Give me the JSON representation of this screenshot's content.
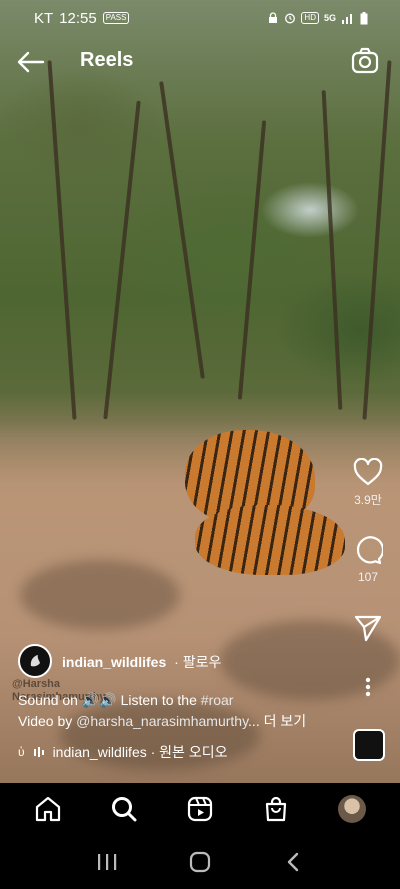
{
  "status_bar": {
    "carrier": "KT",
    "time": "12:55",
    "notification_badge": "PASS",
    "right_icons": [
      "lock-icon",
      "alarm-icon",
      "hd-icon",
      "5g-icon",
      "signal-icon",
      "battery-icon"
    ],
    "hd": "HD",
    "network": "5G"
  },
  "header": {
    "title": "Reels"
  },
  "actions": {
    "like_count": "3.9만",
    "comment_count": "107"
  },
  "watermark": {
    "line1": "@Harsha",
    "line2": "Narasimhamurthy"
  },
  "post": {
    "username": "indian_wildlifes",
    "follow_label": "· 팔로우",
    "caption_line1_prefix": "Sound on ",
    "caption_line1_emoji": "🔊🔊",
    "caption_line1_text": " Listen to the ",
    "caption_hashtag": "#roar",
    "caption_line2_prefix": "Video by ",
    "caption_mention": "@harsha_narasimhamurthy",
    "caption_ellipsis": "...",
    "more_label": " 더 보기"
  },
  "audio": {
    "lead": "ὑ",
    "text": "indian_wildlifes · 원본 오디오"
  },
  "colors": {
    "background": "#000000",
    "text": "#ffffff"
  }
}
